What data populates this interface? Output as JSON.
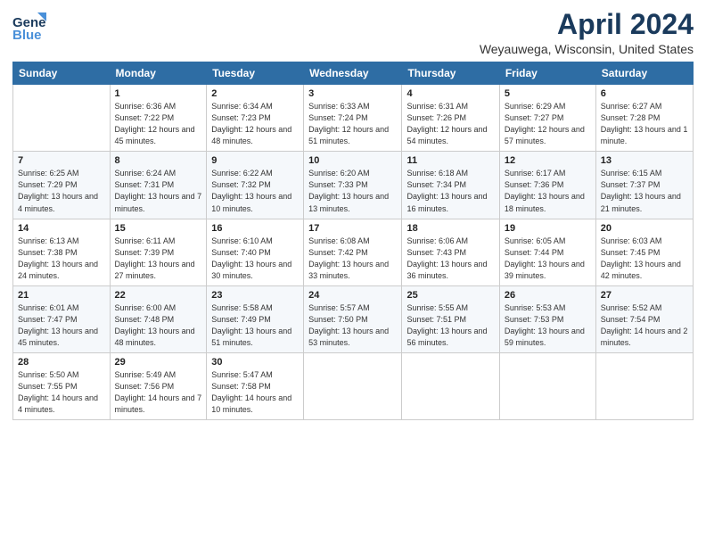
{
  "header": {
    "logo_general": "General",
    "logo_blue": "Blue",
    "month_title": "April 2024",
    "location": "Weyauwega, Wisconsin, United States"
  },
  "weekdays": [
    "Sunday",
    "Monday",
    "Tuesday",
    "Wednesday",
    "Thursday",
    "Friday",
    "Saturday"
  ],
  "weeks": [
    [
      {
        "day": "",
        "sunrise": "",
        "sunset": "",
        "daylight": ""
      },
      {
        "day": "1",
        "sunrise": "Sunrise: 6:36 AM",
        "sunset": "Sunset: 7:22 PM",
        "daylight": "Daylight: 12 hours and 45 minutes."
      },
      {
        "day": "2",
        "sunrise": "Sunrise: 6:34 AM",
        "sunset": "Sunset: 7:23 PM",
        "daylight": "Daylight: 12 hours and 48 minutes."
      },
      {
        "day": "3",
        "sunrise": "Sunrise: 6:33 AM",
        "sunset": "Sunset: 7:24 PM",
        "daylight": "Daylight: 12 hours and 51 minutes."
      },
      {
        "day": "4",
        "sunrise": "Sunrise: 6:31 AM",
        "sunset": "Sunset: 7:26 PM",
        "daylight": "Daylight: 12 hours and 54 minutes."
      },
      {
        "day": "5",
        "sunrise": "Sunrise: 6:29 AM",
        "sunset": "Sunset: 7:27 PM",
        "daylight": "Daylight: 12 hours and 57 minutes."
      },
      {
        "day": "6",
        "sunrise": "Sunrise: 6:27 AM",
        "sunset": "Sunset: 7:28 PM",
        "daylight": "Daylight: 13 hours and 1 minute."
      }
    ],
    [
      {
        "day": "7",
        "sunrise": "Sunrise: 6:25 AM",
        "sunset": "Sunset: 7:29 PM",
        "daylight": "Daylight: 13 hours and 4 minutes."
      },
      {
        "day": "8",
        "sunrise": "Sunrise: 6:24 AM",
        "sunset": "Sunset: 7:31 PM",
        "daylight": "Daylight: 13 hours and 7 minutes."
      },
      {
        "day": "9",
        "sunrise": "Sunrise: 6:22 AM",
        "sunset": "Sunset: 7:32 PM",
        "daylight": "Daylight: 13 hours and 10 minutes."
      },
      {
        "day": "10",
        "sunrise": "Sunrise: 6:20 AM",
        "sunset": "Sunset: 7:33 PM",
        "daylight": "Daylight: 13 hours and 13 minutes."
      },
      {
        "day": "11",
        "sunrise": "Sunrise: 6:18 AM",
        "sunset": "Sunset: 7:34 PM",
        "daylight": "Daylight: 13 hours and 16 minutes."
      },
      {
        "day": "12",
        "sunrise": "Sunrise: 6:17 AM",
        "sunset": "Sunset: 7:36 PM",
        "daylight": "Daylight: 13 hours and 18 minutes."
      },
      {
        "day": "13",
        "sunrise": "Sunrise: 6:15 AM",
        "sunset": "Sunset: 7:37 PM",
        "daylight": "Daylight: 13 hours and 21 minutes."
      }
    ],
    [
      {
        "day": "14",
        "sunrise": "Sunrise: 6:13 AM",
        "sunset": "Sunset: 7:38 PM",
        "daylight": "Daylight: 13 hours and 24 minutes."
      },
      {
        "day": "15",
        "sunrise": "Sunrise: 6:11 AM",
        "sunset": "Sunset: 7:39 PM",
        "daylight": "Daylight: 13 hours and 27 minutes."
      },
      {
        "day": "16",
        "sunrise": "Sunrise: 6:10 AM",
        "sunset": "Sunset: 7:40 PM",
        "daylight": "Daylight: 13 hours and 30 minutes."
      },
      {
        "day": "17",
        "sunrise": "Sunrise: 6:08 AM",
        "sunset": "Sunset: 7:42 PM",
        "daylight": "Daylight: 13 hours and 33 minutes."
      },
      {
        "day": "18",
        "sunrise": "Sunrise: 6:06 AM",
        "sunset": "Sunset: 7:43 PM",
        "daylight": "Daylight: 13 hours and 36 minutes."
      },
      {
        "day": "19",
        "sunrise": "Sunrise: 6:05 AM",
        "sunset": "Sunset: 7:44 PM",
        "daylight": "Daylight: 13 hours and 39 minutes."
      },
      {
        "day": "20",
        "sunrise": "Sunrise: 6:03 AM",
        "sunset": "Sunset: 7:45 PM",
        "daylight": "Daylight: 13 hours and 42 minutes."
      }
    ],
    [
      {
        "day": "21",
        "sunrise": "Sunrise: 6:01 AM",
        "sunset": "Sunset: 7:47 PM",
        "daylight": "Daylight: 13 hours and 45 minutes."
      },
      {
        "day": "22",
        "sunrise": "Sunrise: 6:00 AM",
        "sunset": "Sunset: 7:48 PM",
        "daylight": "Daylight: 13 hours and 48 minutes."
      },
      {
        "day": "23",
        "sunrise": "Sunrise: 5:58 AM",
        "sunset": "Sunset: 7:49 PM",
        "daylight": "Daylight: 13 hours and 51 minutes."
      },
      {
        "day": "24",
        "sunrise": "Sunrise: 5:57 AM",
        "sunset": "Sunset: 7:50 PM",
        "daylight": "Daylight: 13 hours and 53 minutes."
      },
      {
        "day": "25",
        "sunrise": "Sunrise: 5:55 AM",
        "sunset": "Sunset: 7:51 PM",
        "daylight": "Daylight: 13 hours and 56 minutes."
      },
      {
        "day": "26",
        "sunrise": "Sunrise: 5:53 AM",
        "sunset": "Sunset: 7:53 PM",
        "daylight": "Daylight: 13 hours and 59 minutes."
      },
      {
        "day": "27",
        "sunrise": "Sunrise: 5:52 AM",
        "sunset": "Sunset: 7:54 PM",
        "daylight": "Daylight: 14 hours and 2 minutes."
      }
    ],
    [
      {
        "day": "28",
        "sunrise": "Sunrise: 5:50 AM",
        "sunset": "Sunset: 7:55 PM",
        "daylight": "Daylight: 14 hours and 4 minutes."
      },
      {
        "day": "29",
        "sunrise": "Sunrise: 5:49 AM",
        "sunset": "Sunset: 7:56 PM",
        "daylight": "Daylight: 14 hours and 7 minutes."
      },
      {
        "day": "30",
        "sunrise": "Sunrise: 5:47 AM",
        "sunset": "Sunset: 7:58 PM",
        "daylight": "Daylight: 14 hours and 10 minutes."
      },
      {
        "day": "",
        "sunrise": "",
        "sunset": "",
        "daylight": ""
      },
      {
        "day": "",
        "sunrise": "",
        "sunset": "",
        "daylight": ""
      },
      {
        "day": "",
        "sunrise": "",
        "sunset": "",
        "daylight": ""
      },
      {
        "day": "",
        "sunrise": "",
        "sunset": "",
        "daylight": ""
      }
    ]
  ]
}
